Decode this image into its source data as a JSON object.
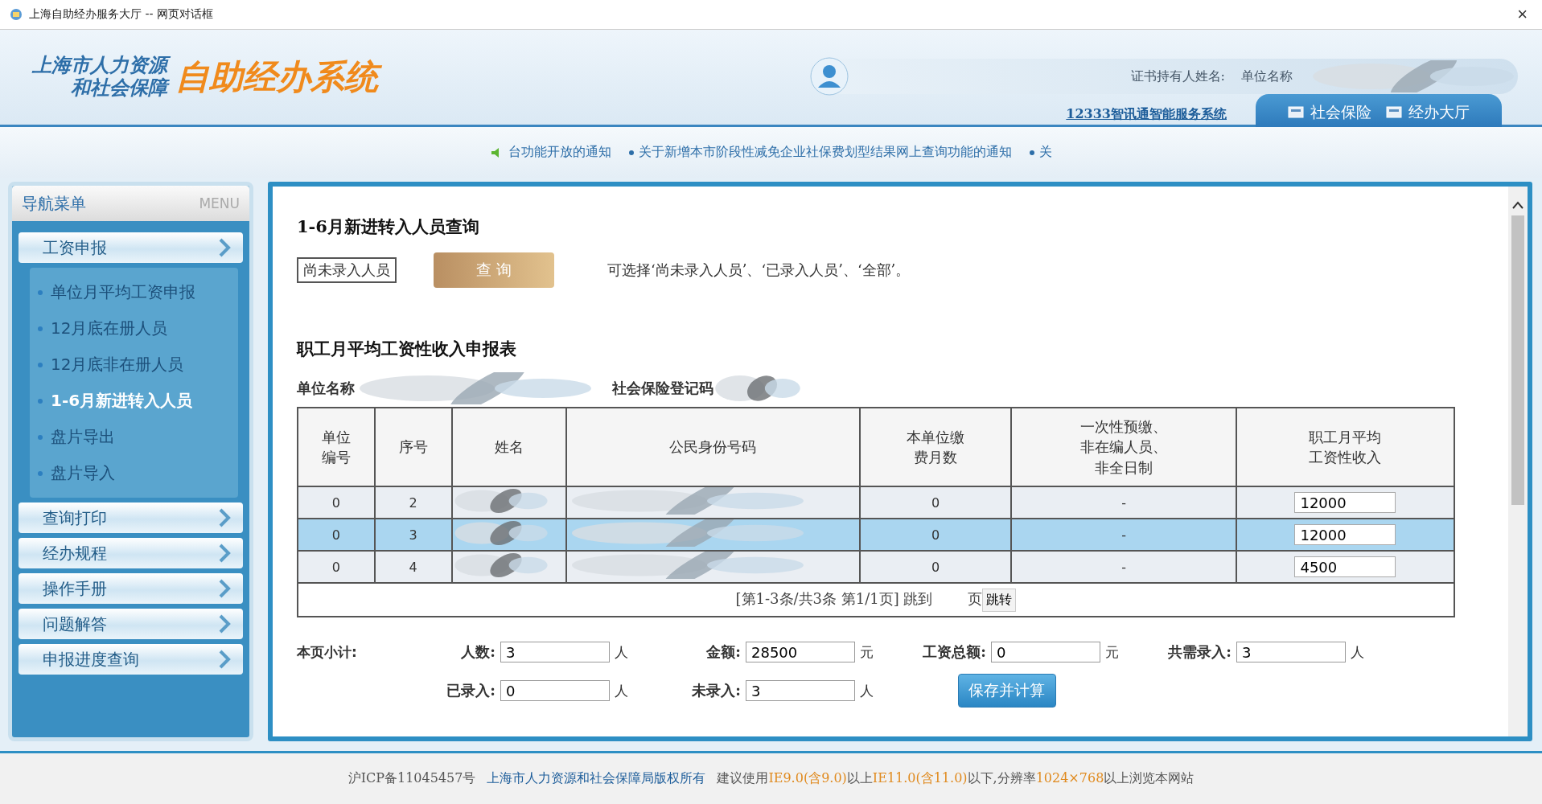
{
  "window": {
    "title": "上海自助经办服务大厅 -- 网页对话框",
    "close": "×"
  },
  "header": {
    "logo_line_1": "上海市人力资源",
    "logo_line_2": "和社会保障",
    "logo_title": "自助经办系统",
    "holder_label": "证书持有人姓名:",
    "unit_label": "单位名称",
    "service_link": "12333智讯通智能服务系统",
    "tabs": [
      "社会保险",
      "经办大厅"
    ]
  },
  "notices": [
    "台功能开放的通知",
    "关于新增本市阶段性减免企业社保费划型结果网上查询功能的通知",
    "关"
  ],
  "sidebar": {
    "title": "导航菜单",
    "subtitle": "MENU",
    "groups": [
      {
        "label": "工资申报",
        "children": [
          {
            "label": "单位月平均工资申报",
            "selected": false
          },
          {
            "label": "12月底在册人员",
            "selected": false
          },
          {
            "label": "12月底非在册人员",
            "selected": false
          },
          {
            "label": "1-6月新进转入人员",
            "selected": true
          },
          {
            "label": "盘片导出",
            "selected": false
          },
          {
            "label": "盘片导入",
            "selected": false
          }
        ]
      },
      {
        "label": "查询打印"
      },
      {
        "label": "经办规程"
      },
      {
        "label": "操作手册"
      },
      {
        "label": "问题解答"
      },
      {
        "label": "申报进度查询"
      }
    ]
  },
  "query": {
    "title": "1-6月新进转入人员查询",
    "filter_value": "尚未录入人员",
    "button": "查 询",
    "hint": "可选择‘尚未录入人员’、‘已录入人员’、‘全部’。"
  },
  "form": {
    "title": "职工月平均工资性收入申报表",
    "unit_name_label": "单位名称",
    "registration_label": "社会保险登记码"
  },
  "table": {
    "columns": [
      "单位编号",
      "序号",
      "姓名",
      "公民身份号码",
      "本单位缴费月数",
      "一次性预缴、非在编人员、非全日制",
      "职工月平均工资性收入"
    ],
    "rows": [
      {
        "unit_no": "0",
        "seq": "2",
        "months": "0",
        "flag": "-",
        "income": "12000",
        "selected": false
      },
      {
        "unit_no": "0",
        "seq": "3",
        "months": "0",
        "flag": "-",
        "income": "12000",
        "selected": true
      },
      {
        "unit_no": "0",
        "seq": "4",
        "months": "0",
        "flag": "-",
        "income": "4500",
        "selected": false
      }
    ],
    "pagination": {
      "text": "[第1-3条/共3条 第1/1页] 跳到",
      "page_suffix": "页",
      "jump_button": "跳转"
    }
  },
  "subtotal": {
    "label": "本页小计:",
    "fields": [
      {
        "label": "人数:",
        "value": "3",
        "unit": "人"
      },
      {
        "label": "金额:",
        "value": "28500",
        "unit": "元"
      },
      {
        "label": "工资总额:",
        "value": "0",
        "unit": "元"
      },
      {
        "label": "共需录入:",
        "value": "3",
        "unit": "人"
      },
      {
        "label": "已录入:",
        "value": "0",
        "unit": "人"
      },
      {
        "label": "未录入:",
        "value": "3",
        "unit": "人"
      }
    ],
    "save_button": "保存并计算"
  },
  "footer": {
    "icp": "沪ICP备11045457号",
    "copyright": "上海市人力资源和社会保障局版权所有",
    "notice": [
      {
        "kind": "plain",
        "text": "建议使用"
      },
      {
        "kind": "highlight",
        "text": "IE9.0(含9.0)"
      },
      {
        "kind": "plain",
        "text": "以上"
      },
      {
        "kind": "highlight",
        "text": "IE11.0(含11.0)"
      },
      {
        "kind": "plain",
        "text": "以下,分辨率"
      },
      {
        "kind": "highlight",
        "text": "1024×768"
      },
      {
        "kind": "plain",
        "text": "以上浏览本网站"
      }
    ]
  }
}
